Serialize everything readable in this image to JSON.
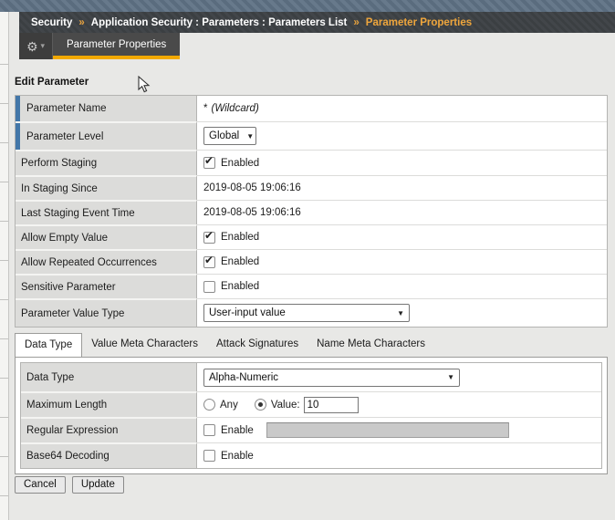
{
  "icons": {
    "gear_icon": "⚙",
    "caret_down_icon": "▾",
    "select_arrow_icon": "▼",
    "chevron_icon": "»"
  },
  "colors": {
    "accent_yellow": "#f2a900",
    "breadcrumb_bg": "#3e4246",
    "breadcrumb_highlight": "#efa63c",
    "row_accent_blue": "#4377a9",
    "banner_stripe_light": "#67798b",
    "banner_stripe_dark": "#5a6c7e",
    "label_cell_bg": "#dcdcda"
  },
  "breadcrumb": {
    "section": "Security",
    "path": "Application Security : Parameters : Parameters List",
    "current": "Parameter Properties"
  },
  "tab_bar": {
    "active_tab": "Parameter Properties"
  },
  "form": {
    "heading": "Edit Parameter",
    "parameter_name": {
      "label": "Parameter Name",
      "value_star": "*",
      "value_note": "(Wildcard)"
    },
    "parameter_level": {
      "label": "Parameter Level",
      "value": "Global"
    },
    "perform_staging": {
      "label": "Perform Staging",
      "value": "Enabled",
      "checked": true
    },
    "in_staging_since": {
      "label": "In Staging Since",
      "value": "2019-08-05 19:06:16"
    },
    "last_staging_event_time": {
      "label": "Last Staging Event Time",
      "value": "2019-08-05 19:06:16"
    },
    "allow_empty_value": {
      "label": "Allow Empty Value",
      "value": "Enabled",
      "checked": true
    },
    "allow_repeated_occurrences": {
      "label": "Allow Repeated Occurrences",
      "value": "Enabled",
      "checked": true
    },
    "sensitive_parameter": {
      "label": "Sensitive Parameter",
      "value": "Enabled",
      "checked": false
    },
    "parameter_value_type": {
      "label": "Parameter Value Type",
      "value": "User-input value"
    }
  },
  "tabs": {
    "active": "Data Type",
    "items": [
      "Data Type",
      "Value Meta Characters",
      "Attack Signatures",
      "Name Meta Characters"
    ]
  },
  "data_type_panel": {
    "data_type": {
      "label": "Data Type",
      "value": "Alpha-Numeric"
    },
    "maximum_length": {
      "label": "Maximum Length",
      "option_any": "Any",
      "any_selected": false,
      "option_value": "Value:",
      "value_selected": true,
      "value": "10"
    },
    "regular_expression": {
      "label": "Regular Expression",
      "checkbox_label": "Enable",
      "checked": false,
      "value": ""
    },
    "base64_decoding": {
      "label": "Base64 Decoding",
      "checkbox_label": "Enable",
      "checked": false
    }
  },
  "actions": {
    "cancel": "Cancel",
    "update": "Update"
  }
}
